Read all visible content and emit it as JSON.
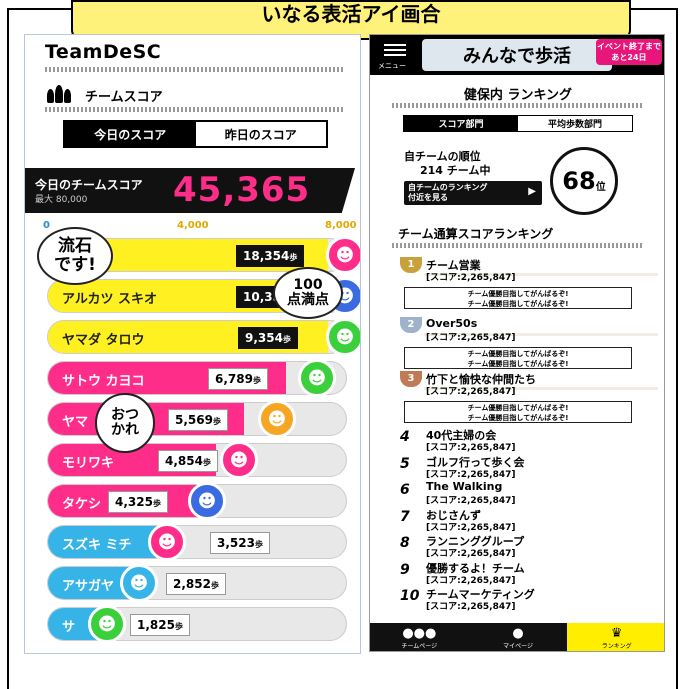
{
  "banner": {
    "text": "いなる表活アイ画合"
  },
  "left": {
    "brand": "TeamDeSC",
    "section_title": "チームスコア",
    "tabs": {
      "today": "今日のスコア",
      "yesterday": "昨日のスコア"
    },
    "score": {
      "label": "今日のチームスコア",
      "max": "最大 80,000",
      "value": "45,365"
    },
    "axis": {
      "zero": "0",
      "mid": "4,000",
      "max": "8,000"
    },
    "unit": "歩",
    "members": [
      {
        "name": "タロウ",
        "steps": "18,354",
        "fill": 1.0,
        "color": "#fff021",
        "face": "#ff2d8a",
        "dark": true
      },
      {
        "name": "アルカツ スキオ",
        "steps": "10,35",
        "fill": 1.0,
        "color": "#fff021",
        "face": "#3a6be0",
        "dark": true
      },
      {
        "name": "ヤマダ タロウ",
        "steps": "9,354",
        "fill": 1.0,
        "color": "#fff021",
        "face": "#3ccf3c",
        "dark": true
      },
      {
        "name": "サトウ カヨコ",
        "steps": "6,789",
        "fill": 0.85,
        "color": "#ff2d8a",
        "face": "#3ccf3c",
        "dark": false
      },
      {
        "name": "ヤマ",
        "steps": "5,569",
        "fill": 0.7,
        "color": "#ff2d8a",
        "face": "#f6a623",
        "dark": false
      },
      {
        "name": "モリワキ",
        "steps": "4,854",
        "fill": 0.6,
        "color": "#ff2d8a",
        "face": "#ff2d8a",
        "dark": false
      },
      {
        "name": "タケシ",
        "steps": "4,325",
        "fill": 0.54,
        "color": "#ff2d8a",
        "face": "#3a6be0",
        "dark": false
      },
      {
        "name": "スズキ ミチ",
        "steps": "3,523",
        "fill": 0.44,
        "color": "#36b4e8",
        "face": "#ff2d8a",
        "dark": false
      },
      {
        "name": "アサガヤ",
        "steps": "2,852",
        "fill": 0.36,
        "color": "#36b4e8",
        "face": "#36b4e8",
        "dark": false
      },
      {
        "name": "サ",
        "steps": "1,825",
        "fill": 0.23,
        "color": "#36b4e8",
        "face": "#3ccf3c",
        "dark": false
      }
    ],
    "bubbles": {
      "great": "流石\nです!",
      "hundred": "100\n点満点",
      "tired": "おつ\nかれ"
    }
  },
  "right": {
    "menu_label": "メニュー",
    "logo_text": "みんなで歩活",
    "event_badge": "イベント終了まで\nあと24日",
    "title": "健保内 ランキング",
    "tabs": {
      "score": "スコア部門",
      "avg": "平均歩数部門"
    },
    "rank_label": "自チームの順位",
    "rank_sub": "214 チーム中",
    "nearby_btn": "自チームのランキング\n付近を見る",
    "rank_value": "68",
    "rank_unit": "位",
    "subhead": "チーム通算スコアランキング",
    "message": "チーム優勝目指してがんばるぞ!\nチーム優勝目指してがんばるぞ!",
    "teams": [
      {
        "rank": "1",
        "name": "チーム営業",
        "score": "[スコア:2,265,847]"
      },
      {
        "rank": "2",
        "name": "Over50s",
        "score": "[スコア:2,265,847]"
      },
      {
        "rank": "3",
        "name": "竹下と愉快な仲間たち",
        "score": "[スコア:2,265,847]"
      },
      {
        "rank": "4",
        "name": "40代主婦の会",
        "score": "[スコア:2,265,847]"
      },
      {
        "rank": "5",
        "name": "ゴルフ行って歩く会",
        "score": "[スコア:2,265,847]"
      },
      {
        "rank": "6",
        "name": "The Walking",
        "score": "[スコア:2,265,847]"
      },
      {
        "rank": "7",
        "name": "おじさんず",
        "score": "[スコア:2,265,847]"
      },
      {
        "rank": "8",
        "name": "ランニンググループ",
        "score": "[スコア:2,265,847]"
      },
      {
        "rank": "9",
        "name": "優勝するよ！チーム",
        "score": "[スコア:2,265,847]"
      },
      {
        "rank": "10",
        "name": "チームマーケティング",
        "score": "[スコア:2,265,847]"
      }
    ],
    "tabbar": {
      "team": "チームページ",
      "mypage": "マイページ",
      "ranking": "ランキング"
    },
    "trophy_colors": [
      "#c9a13b",
      "#9fb2c9",
      "#c07a55"
    ]
  }
}
